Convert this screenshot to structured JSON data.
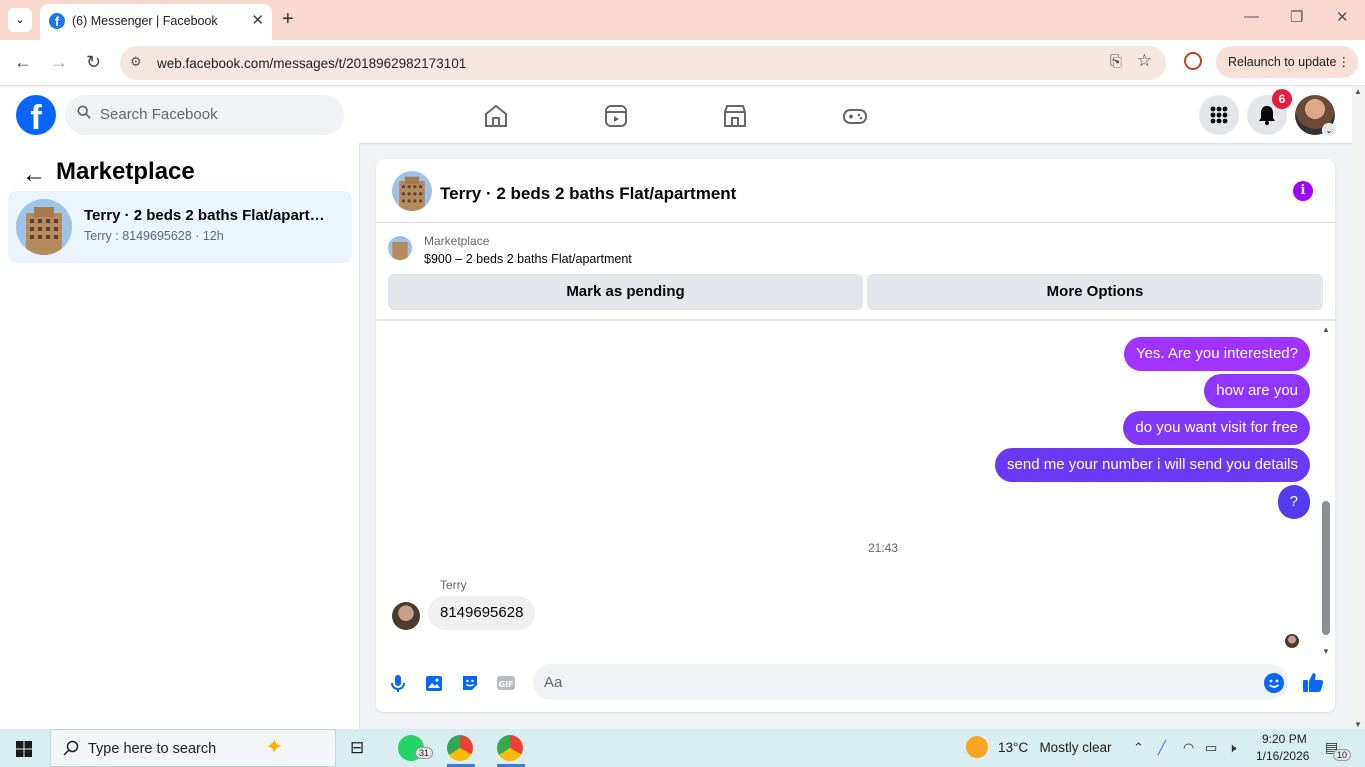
{
  "browser": {
    "tab_title": "(6) Messenger | Facebook",
    "url": "web.facebook.com/messages/t/2018962982173101",
    "relaunch_label": "Relaunch to update"
  },
  "fb": {
    "search_placeholder": "Search Facebook",
    "notification_count": "6"
  },
  "left_panel": {
    "title": "Marketplace",
    "conversation": {
      "name": "Terry · 2 beds 2 baths Flat/apartment",
      "preview": "Terry : 8149695628 · 12h"
    }
  },
  "chat": {
    "header_name": "Terry · 2 beds 2 baths Flat/apartment",
    "marketplace_label": "Marketplace",
    "listing": "$900 – 2 beds 2 baths Flat/apartment",
    "mark_pending_label": "Mark as pending",
    "more_options_label": "More Options",
    "messages_sent": [
      "Yes. Are you interested?",
      "how are you",
      "do you want visit for free",
      "send me your number i will send you details",
      "?"
    ],
    "timestamp": "21:43",
    "sender_name": "Terry",
    "received_message": "8149695628",
    "composer_placeholder": "Aa",
    "colors": {
      "bubble_top": "#a033ff",
      "bubble_bottom": "#4f3cf0"
    }
  },
  "taskbar": {
    "search_placeholder": "Type here to search",
    "whatsapp_badge": "31",
    "weather_temp": "13°C",
    "weather_desc": "Mostly clear",
    "time": "9:20 PM",
    "date": "1/16/2026",
    "notif_count": "10"
  }
}
